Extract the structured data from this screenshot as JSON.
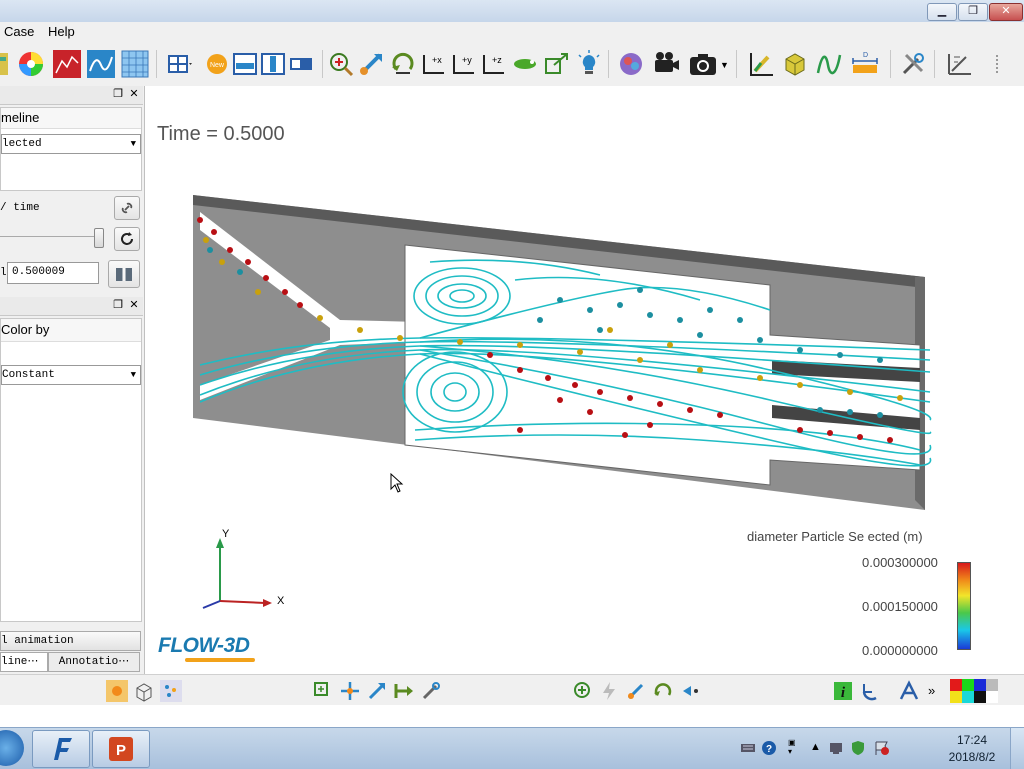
{
  "window": {
    "minimize_glyph": "▁",
    "maximize_glyph": "❐",
    "close_glyph": "✕",
    "close_color": "#c75050"
  },
  "menu": {
    "items": [
      "Case",
      "Help"
    ]
  },
  "toolbar": {
    "icons": [
      "palette-icon",
      "color-wheel-icon",
      "history-plot-icon",
      "probe-icon",
      "mesh-icon",
      "layout-icon",
      "new-icon",
      "view-split-h-icon",
      "view-split-v-icon",
      "view-icon",
      "zoom-fit-icon",
      "pan-icon",
      "rotate-icon",
      "axis-x-icon",
      "axis-y-icon",
      "axis-z-icon",
      "fly-icon",
      "export-view-icon",
      "light-icon",
      "render-icon",
      "movie-icon",
      "camera-icon",
      "chart-icon",
      "cube-icon",
      "streamline-icon",
      "dimension-icon",
      "tools-icon",
      "ruler-icon"
    ]
  },
  "left_panel": {
    "streamline_label": "meline",
    "selection_combo": "lected",
    "time_label": "time",
    "time_value": "0.500009",
    "colorby_label": "Color by",
    "colorby_combo": "Constant",
    "anim_button": "l animation settings...",
    "tab_streamline": "line⋯",
    "tab_annotation": "Annotatio⋯"
  },
  "viewport": {
    "time_text": "Time = 0.5000",
    "axis_y": "Y",
    "axis_x": "X",
    "logo_text": "FLOW-3D",
    "legend": {
      "title": "diameter Particle Se ected (m)",
      "max": "0.000300000",
      "mid": "0.000150000",
      "min": "0.000000000"
    }
  },
  "colors": {
    "streamline": "#1fbcc4",
    "geometry": "#8e8e8e",
    "particle_small": "#1c8fa0",
    "particle_mid": "#c9a10c",
    "particle_large": "#b80f14"
  },
  "taskbar": {
    "time": "17:24",
    "date": "2018/8/2"
  }
}
